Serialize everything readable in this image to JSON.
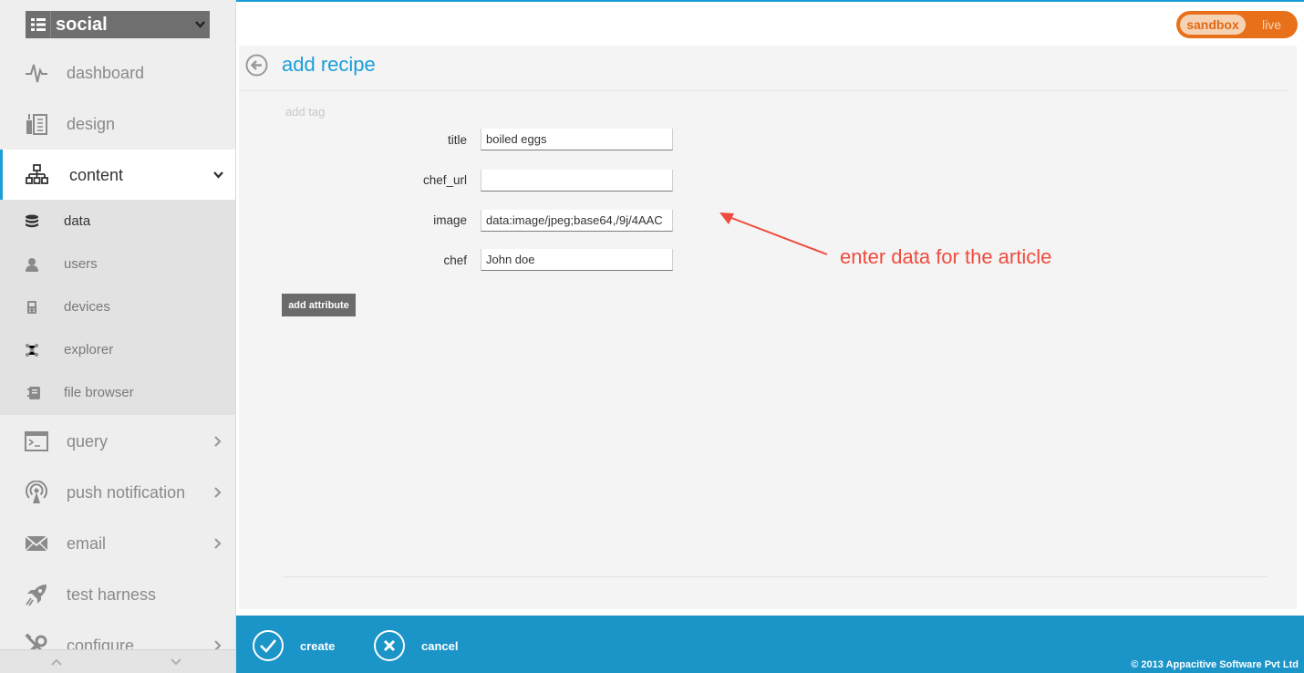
{
  "app_selector": {
    "name": "social",
    "icon": "list-icon"
  },
  "environment": {
    "sandbox_label": "sandbox",
    "live_label": "live",
    "selected": "sandbox"
  },
  "sidebar": {
    "items": [
      {
        "label": "dashboard",
        "icon": "pulse-icon"
      },
      {
        "label": "design",
        "icon": "design-icon"
      },
      {
        "label": "content",
        "icon": "hierarchy-icon",
        "active": true,
        "expanded": true
      },
      {
        "label": "query",
        "icon": "terminal-icon"
      },
      {
        "label": "push notification",
        "icon": "broadcast-icon"
      },
      {
        "label": "email",
        "icon": "envelope-icon"
      },
      {
        "label": "test harness",
        "icon": "rocket-icon"
      },
      {
        "label": "configure",
        "icon": "tools-icon"
      }
    ],
    "sub_items": [
      {
        "label": "data",
        "icon": "database-icon",
        "active": true
      },
      {
        "label": "users",
        "icon": "user-icon"
      },
      {
        "label": "devices",
        "icon": "device-icon"
      },
      {
        "label": "explorer",
        "icon": "graph-icon"
      },
      {
        "label": "file browser",
        "icon": "file-icon"
      }
    ]
  },
  "main": {
    "title": "add recipe",
    "add_tag_label": "add tag",
    "fields": [
      {
        "label": "title",
        "value": "boiled eggs"
      },
      {
        "label": "chef_url",
        "value": ""
      },
      {
        "label": "image",
        "value": "data:image/jpeg;base64,/9j/4AAC"
      },
      {
        "label": "chef",
        "value": "John doe"
      }
    ],
    "add_attribute_label": "add attribute"
  },
  "annotation": {
    "text": "enter data for the article",
    "color": "#ef4b3e"
  },
  "footer": {
    "create_label": "create",
    "cancel_label": "cancel",
    "copyright": "© 2013 Appacitive Software Pvt Ltd"
  },
  "colors": {
    "accent": "#1b9ed8",
    "footer": "#1b94c8",
    "toggle": "#e8701a"
  }
}
